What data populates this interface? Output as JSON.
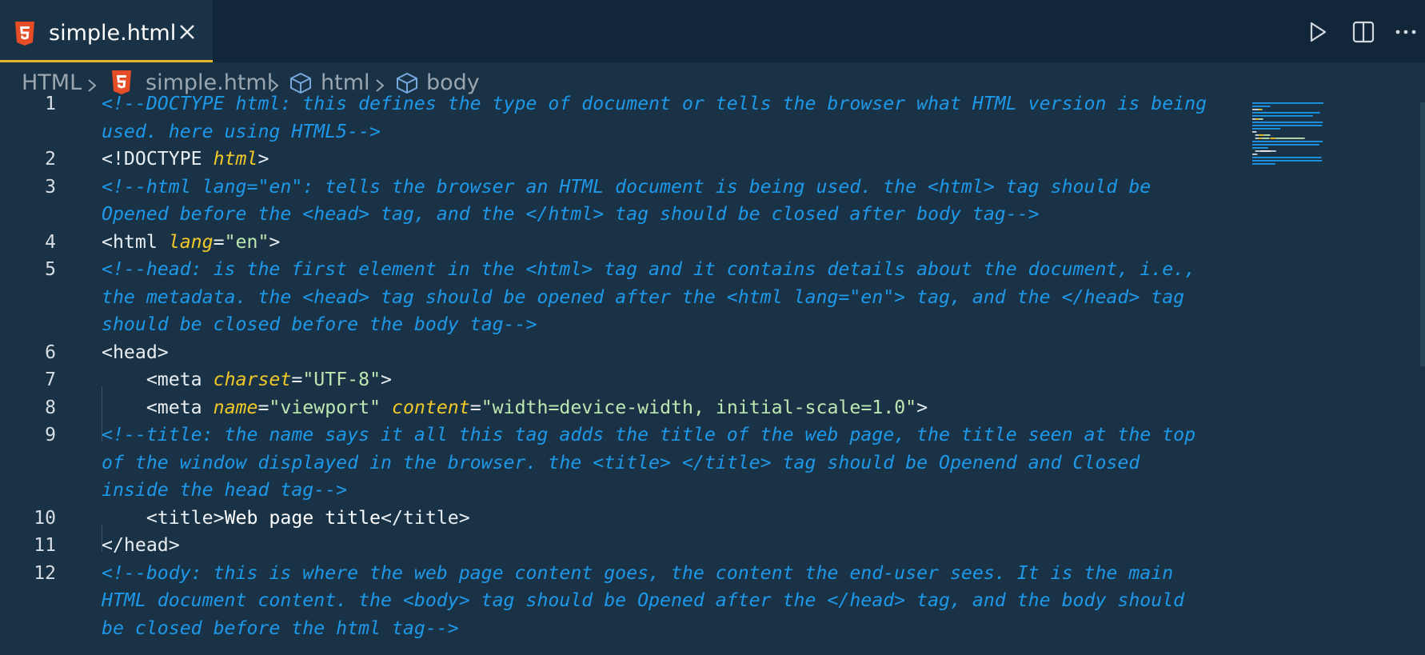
{
  "tab": {
    "filename": "simple.html",
    "file_icon": "html5-icon",
    "close_icon": "close-icon"
  },
  "actions": {
    "run": "play-icon",
    "split": "split-editor-icon",
    "more": "more-icon"
  },
  "breadcrumb": {
    "root": "HTML",
    "file": "simple.html",
    "sym1": "html",
    "sym2": "body",
    "separator": ">"
  },
  "colors": {
    "background": "#1a3246",
    "tabbar": "#12263a",
    "active_tab_border": "#e8b42c",
    "comment": "#1e98e8",
    "attribute": "#f0c828",
    "string": "#bde6b0",
    "tag": "#e8eef2"
  },
  "lines": [
    {
      "num": "1",
      "rows": [
        [
          [
            "cm",
            "<!--DOCTYPE html: this defines the type of document or tells the browser what HTML version is being"
          ]
        ],
        [
          [
            "cm",
            "used. here using HTML5-->"
          ]
        ]
      ]
    },
    {
      "num": "2",
      "rows": [
        [
          [
            "tg",
            "<!DOCTYPE "
          ],
          [
            "at",
            "html"
          ],
          [
            "tg",
            ">"
          ]
        ]
      ]
    },
    {
      "num": "3",
      "rows": [
        [
          [
            "cm",
            "<!--html lang=\"en\": tells the browser an HTML document is being used. the <html> tag should be"
          ]
        ],
        [
          [
            "cm",
            "Opened before the <head> tag, and the </html> tag should be closed after body tag-->"
          ]
        ]
      ]
    },
    {
      "num": "4",
      "rows": [
        [
          [
            "tg",
            "<html "
          ],
          [
            "at",
            "lang"
          ],
          [
            "tg",
            "="
          ],
          [
            "st",
            "\"en\""
          ],
          [
            "tg",
            ">"
          ]
        ]
      ]
    },
    {
      "num": "5",
      "rows": [
        [
          [
            "cm",
            "<!--head: is the first element in the <html> tag and it contains details about the document, i.e.,"
          ]
        ],
        [
          [
            "cm",
            "the metadata. the <head> tag should be opened after the <html lang=\"en\"> tag, and the </head> tag"
          ]
        ],
        [
          [
            "cm",
            "should be closed before the body tag-->"
          ]
        ]
      ]
    },
    {
      "num": "6",
      "rows": [
        [
          [
            "tg",
            "<head>"
          ]
        ]
      ]
    },
    {
      "num": "7",
      "rows": [
        [
          [
            "tg",
            "    <meta "
          ],
          [
            "at",
            "charset"
          ],
          [
            "tg",
            "="
          ],
          [
            "st",
            "\"UTF-8\""
          ],
          [
            "tg",
            ">"
          ]
        ]
      ]
    },
    {
      "num": "8",
      "rows": [
        [
          [
            "tg",
            "    <meta "
          ],
          [
            "at",
            "name"
          ],
          [
            "tg",
            "="
          ],
          [
            "st",
            "\"viewport\""
          ],
          [
            "tg",
            " "
          ],
          [
            "at",
            "content"
          ],
          [
            "tg",
            "="
          ],
          [
            "st",
            "\"width=device-width, initial-scale=1.0\""
          ],
          [
            "tg",
            ">"
          ]
        ]
      ]
    },
    {
      "num": "9",
      "rows": [
        [
          [
            "cm",
            "<!--title: the name says it all this tag adds the title of the web page, the title seen at the top"
          ]
        ],
        [
          [
            "cm",
            "of the window displayed in the browser. the <title> </title> tag should be Openend and Closed"
          ]
        ],
        [
          [
            "cm",
            "inside the head tag-->"
          ]
        ]
      ]
    },
    {
      "num": "10",
      "rows": [
        [
          [
            "tg",
            "    <title>"
          ],
          [
            "tx",
            "Web page title"
          ],
          [
            "tg",
            "</title>"
          ]
        ]
      ]
    },
    {
      "num": "11",
      "rows": [
        [
          [
            "tg",
            "</head>"
          ]
        ]
      ]
    },
    {
      "num": "12",
      "rows": [
        [
          [
            "cm",
            "<!--body: this is where the web page content goes, the content the end-user sees. It is the main"
          ]
        ],
        [
          [
            "cm",
            "HTML document content. the <body> tag should be Opened after the </head> tag, and the body should"
          ]
        ],
        [
          [
            "cm",
            "be closed before the html tag-->"
          ]
        ]
      ]
    }
  ]
}
